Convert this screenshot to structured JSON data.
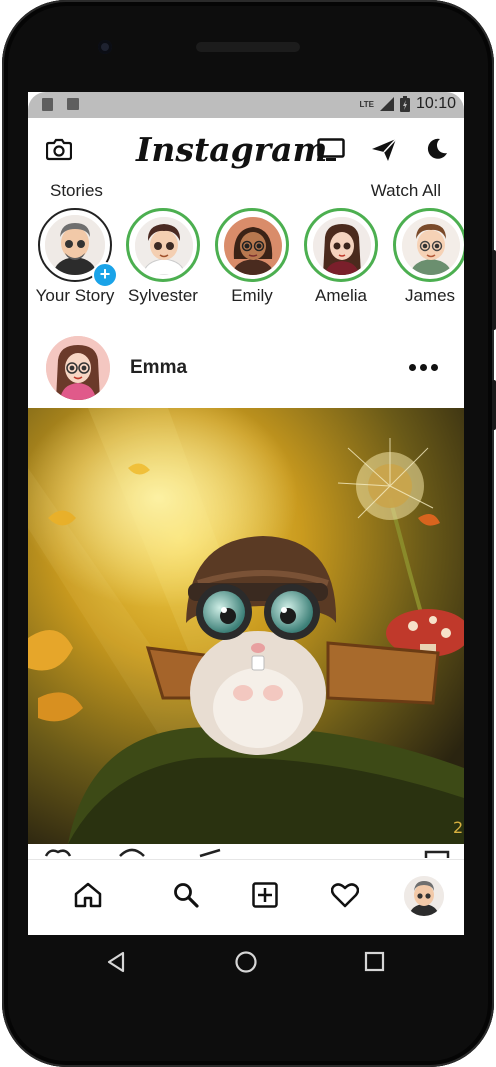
{
  "status_bar": {
    "network": "LTE",
    "time": "10:10"
  },
  "header": {
    "logo": "Instagram"
  },
  "stories_section": {
    "title": "Stories",
    "watch_all": "Watch All"
  },
  "stories": [
    {
      "name": "Your Story",
      "self": true
    },
    {
      "name": "Sylvester",
      "self": false
    },
    {
      "name": "Emily",
      "self": false
    },
    {
      "name": "Amelia",
      "self": false
    },
    {
      "name": "James",
      "self": false
    }
  ],
  "post": {
    "username": "Emma"
  },
  "icons": {
    "camera": "camera-icon",
    "tv": "tv-icon",
    "send": "paper-plane-icon",
    "theme": "moon-icon",
    "home": "home-icon",
    "search": "search-icon",
    "add": "add-square-icon",
    "like": "heart-icon"
  },
  "colors": {
    "story_ring": "#4caf50",
    "add_badge": "#1aa3e8"
  }
}
